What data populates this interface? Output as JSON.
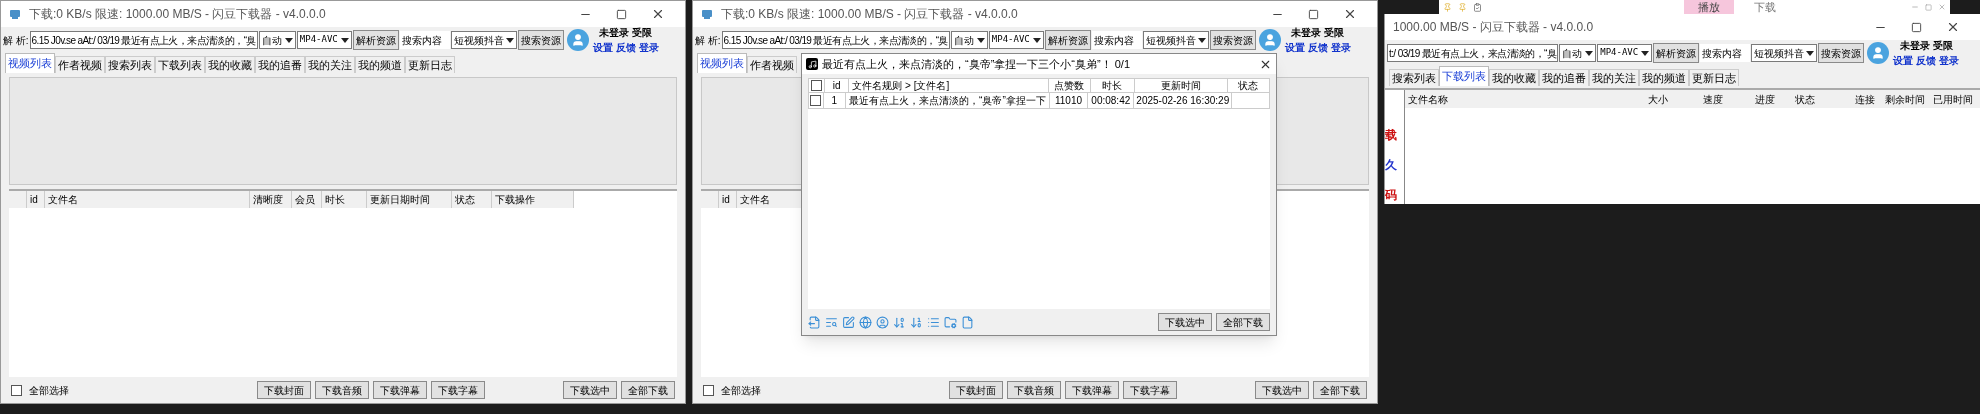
{
  "windows": [
    {
      "title": "下载:0 KB/s  限速:  1000.00 MB/S  - 闪豆下载器 - v4.0.0.0",
      "parse_label": "解 析:",
      "parse_value": "6.15 J0v.se aAt:/ 03/19 最近有点上火，来点清淡的，“臭",
      "quality": "自动",
      "format": "MP4-AVC",
      "parse_button": "解析资源",
      "search_value": "搜索内容",
      "platform": "短视频抖音",
      "search_button": "搜索资源",
      "user_name": "未登录",
      "user_level": "受限",
      "links": [
        "设置",
        "反馈",
        "登录"
      ],
      "tabs": [
        {
          "label": "视频列表",
          "selected": true
        },
        {
          "label": "作者视频",
          "selected": false
        },
        {
          "label": "搜索列表",
          "selected": false
        },
        {
          "label": "下载列表",
          "selected": false
        },
        {
          "label": "我的收藏",
          "selected": false
        },
        {
          "label": "我的追番",
          "selected": false
        },
        {
          "label": "我的关注",
          "selected": false
        },
        {
          "label": "我的频道",
          "selected": false
        },
        {
          "label": "更新日志",
          "selected": false
        }
      ],
      "columns": [
        "id",
        "文件名",
        "清晰度",
        "会员",
        "时长",
        "更新日期时间",
        "状态",
        "下载操作"
      ],
      "select_all": {
        "label": "全部选择",
        "checked": false
      },
      "buttons_left": [
        "下载封面",
        "下载音频",
        "下载弹幕",
        "下载字幕"
      ],
      "buttons_right": [
        "下载选中",
        "全部下载"
      ]
    },
    {
      "title": "下载:0 KB/s  限速:  1000.00 MB/S  - 闪豆下载器 - v4.0.0.0",
      "parse_label": "解 析:",
      "parse_value": "6.15 J0v.se aAt:/ 03/19 最近有点上火，来点清淡的，“臭",
      "quality": "自动",
      "format": "MP4-AVC",
      "parse_button": "解析资源",
      "search_value": "搜索内容",
      "platform": "短视频抖音",
      "search_button": "搜索资源",
      "user_name": "未登录",
      "user_level": "受限",
      "links": [
        "设置",
        "反馈",
        "登录"
      ],
      "tabs": [
        {
          "label": "视频列表",
          "selected": true
        },
        {
          "label": "作者视频",
          "selected": false
        }
      ],
      "columns": [
        "id",
        "文件名"
      ],
      "select_all": {
        "label": "全部选择",
        "checked": false
      },
      "buttons_left": [
        "下载封面",
        "下载音频",
        "下载弹幕",
        "下载字幕"
      ],
      "buttons_right": [
        "下载选中",
        "全部下载"
      ]
    }
  ],
  "dialog": {
    "title": "最近有点上火，来点清淡的，“臭帝”拿捏一下三个小“臭弟”！ 0/1",
    "header_checked": false,
    "columns": [
      "id",
      "文件名规则  >  [文件名]",
      "点赞数",
      "时长",
      "更新时间",
      "状态"
    ],
    "rows": [
      {
        "checked": false,
        "cells": [
          "1",
          "最近有点上火，来点清淡的，“臭帝”拿捏一下",
          "11010",
          "00:08:42",
          "2025-02-26 16:30:29"
        ]
      }
    ],
    "buttons": [
      "下载选中",
      "全部下载"
    ]
  },
  "background_window": {
    "tabs": [
      {
        "label": "播放",
        "selected": true
      },
      {
        "label": "下载",
        "selected": false
      }
    ]
  },
  "download_window": {
    "title": "1000.00 MB/S  - 闪豆下载器 - v4.0.0.0",
    "parse_value": "t:/ 03/19 最近有点上火，来点清淡的，“臭",
    "quality": "自动",
    "format": "MP4-AVC",
    "parse_button": "解析资源",
    "search_value": "搜索内容",
    "platform": "短视频抖音",
    "search_button": "搜索资源",
    "user_name": "未登录",
    "user_level": "受限",
    "links": [
      "设置",
      "反馈",
      "登录"
    ],
    "tabs": [
      {
        "label": "搜索列表",
        "selected": false
      },
      {
        "label": "下载列表",
        "selected": true
      },
      {
        "label": "我的收藏",
        "selected": false
      },
      {
        "label": "我的追番",
        "selected": false
      },
      {
        "label": "我的关注",
        "selected": false
      },
      {
        "label": "我的频道",
        "selected": false
      },
      {
        "label": "更新日志",
        "selected": false
      }
    ],
    "side_items": [
      {
        "label": "载",
        "color": "#cc1111"
      },
      {
        "label": "久",
        "color": "#2233cc"
      },
      {
        "label": "码",
        "color": "#cc1111"
      }
    ],
    "columns": [
      "文件名称",
      "大小",
      "速度",
      "进度",
      "状态",
      "连接",
      "剩余时间",
      "已用时间"
    ]
  }
}
